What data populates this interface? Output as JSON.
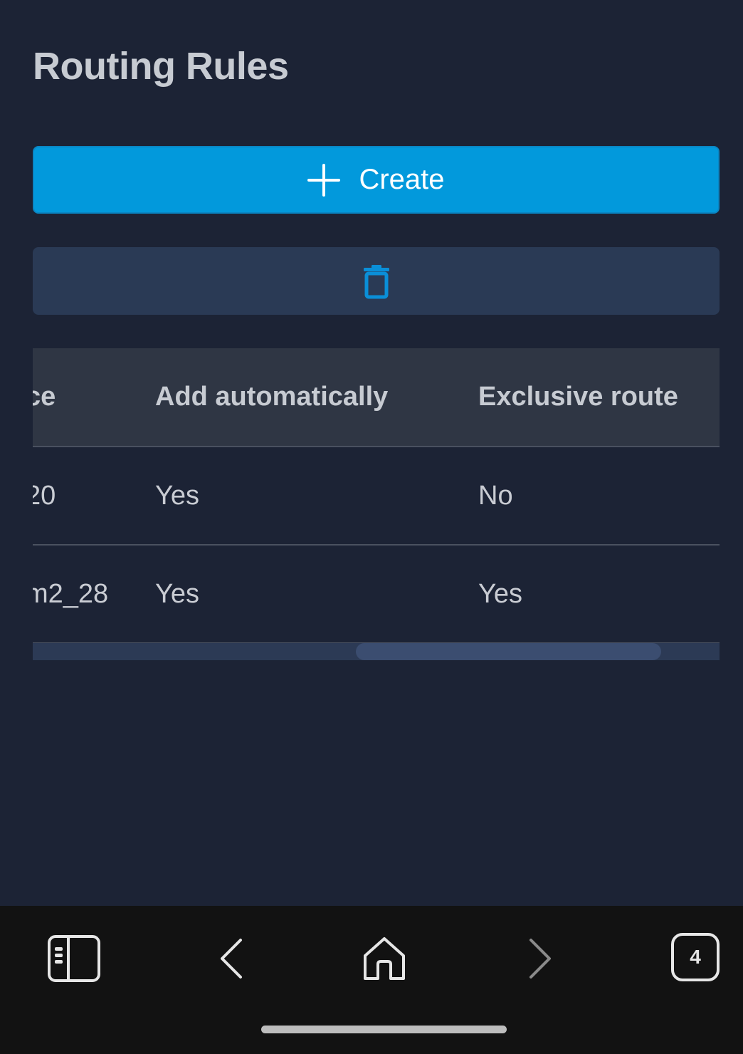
{
  "page": {
    "title": "Routing Rules"
  },
  "actions": {
    "create_label": "Create",
    "create_icon": "plus-icon",
    "delete_icon": "trash-icon",
    "accent": "#0299dc"
  },
  "table": {
    "headers": [
      "ce",
      "Add automatically",
      "Exclusive route"
    ],
    "rows": [
      [
        "20",
        "Yes",
        "No"
      ],
      [
        "m2_28",
        "Yes",
        "Yes"
      ]
    ]
  },
  "browser_bar": {
    "tabs_icon": "sidebar-icon",
    "back_icon": "chevron-left-icon",
    "home_icon": "home-icon",
    "forward_icon": "chevron-right-icon",
    "tab_count": "4"
  }
}
